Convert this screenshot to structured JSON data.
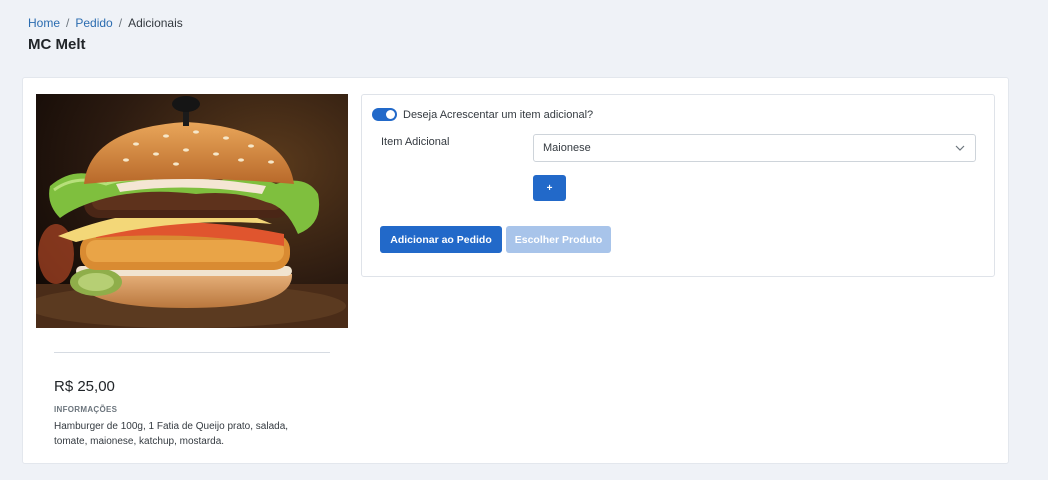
{
  "breadcrumb": {
    "home": "Home",
    "separator": "/",
    "pedido": "Pedido",
    "current": "Adicionais"
  },
  "page": {
    "title": "MC Melt"
  },
  "product": {
    "image_alt": "burger-photo",
    "price": "R$ 25,00",
    "info_label": "INFORMAÇÕES",
    "info_text": "Hamburger de 100g, 1 Fatia de Queijo prato, salada, tomate, maionese, katchup, mostarda."
  },
  "addon": {
    "toggle_label": "Deseja Acrescentar um item adicional?",
    "toggle_on": true,
    "field_label": "Item Adicional",
    "selected_value": "Maionese",
    "plus_label": "+",
    "add_button": "Adicionar ao Pedido",
    "choose_button": "Escolher Produto"
  },
  "colors": {
    "primary": "#2269c9",
    "primary_disabled": "#a8c4ea",
    "link": "#2b6cb0",
    "background": "#eff2f7"
  }
}
